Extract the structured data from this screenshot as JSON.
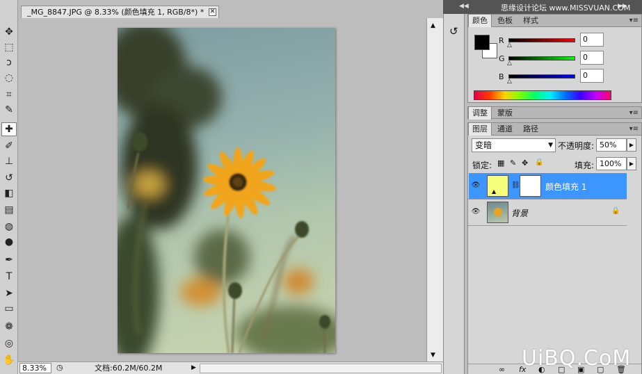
{
  "document": {
    "tab_title": "_MG_8847.JPG @ 8.33% (颜色填充 1, RGB/8*) *",
    "tab_close": "✕"
  },
  "status": {
    "zoom": "8.33%",
    "doc_size": "文档:60.2M/60.2M",
    "arrow": "▶"
  },
  "tools": [
    {
      "name": "move-tool",
      "glyph": "✥"
    },
    {
      "name": "marquee-tool",
      "glyph": "⬚"
    },
    {
      "name": "lasso-tool",
      "glyph": "ↄ"
    },
    {
      "name": "quick-selection-tool",
      "glyph": "◌"
    },
    {
      "name": "crop-tool",
      "glyph": "⌗"
    },
    {
      "name": "eyedropper-tool",
      "glyph": "✎"
    },
    {
      "name": "healing-brush-tool",
      "glyph": "✚"
    },
    {
      "name": "brush-tool",
      "glyph": "✐"
    },
    {
      "name": "clone-stamp-tool",
      "glyph": "⊥"
    },
    {
      "name": "history-brush-tool",
      "glyph": "↺"
    },
    {
      "name": "eraser-tool",
      "glyph": "◧"
    },
    {
      "name": "gradient-tool",
      "glyph": "▤"
    },
    {
      "name": "blur-tool",
      "glyph": "◍"
    },
    {
      "name": "dodge-tool",
      "glyph": "●"
    },
    {
      "name": "pen-tool",
      "glyph": "✒"
    },
    {
      "name": "type-tool",
      "glyph": "T"
    },
    {
      "name": "path-selection-tool",
      "glyph": "➤"
    },
    {
      "name": "shape-tool",
      "glyph": "▭"
    },
    {
      "name": "3d-rotate-tool",
      "glyph": "❁"
    },
    {
      "name": "3d-orbit-tool",
      "glyph": "◎"
    },
    {
      "name": "hand-tool",
      "glyph": "✋"
    }
  ],
  "color_panel": {
    "tabs": [
      "颜色",
      "色板",
      "样式"
    ],
    "r_label": "R",
    "g_label": "G",
    "b_label": "B",
    "r_value": "0",
    "g_value": "0",
    "b_value": "0",
    "menu_glyph": "▾≡"
  },
  "adjust_panel": {
    "tabs": [
      "调整",
      "蒙版"
    ]
  },
  "layers_panel": {
    "tabs": [
      "图层",
      "通道",
      "路径"
    ],
    "blend_mode": "变暗",
    "opacity_label": "不透明度:",
    "opacity_value": "50%",
    "lock_label": "锁定:",
    "fill_label": "填充:",
    "fill_value": "100%",
    "layers": [
      {
        "name": "颜色填充 1",
        "selected": true
      },
      {
        "name": "背景",
        "selected": false
      }
    ],
    "footer_icons": [
      "∞",
      "fx",
      "◐",
      "□",
      "▣",
      "🗑"
    ]
  },
  "colors": {
    "fill_color": "#f6ff7a",
    "selected_row": "#3d95ff"
  },
  "watermark": {
    "top": "思缘设计论坛 www.MISSVUAN.COM",
    "bottom": "UiBQ.CoM"
  }
}
